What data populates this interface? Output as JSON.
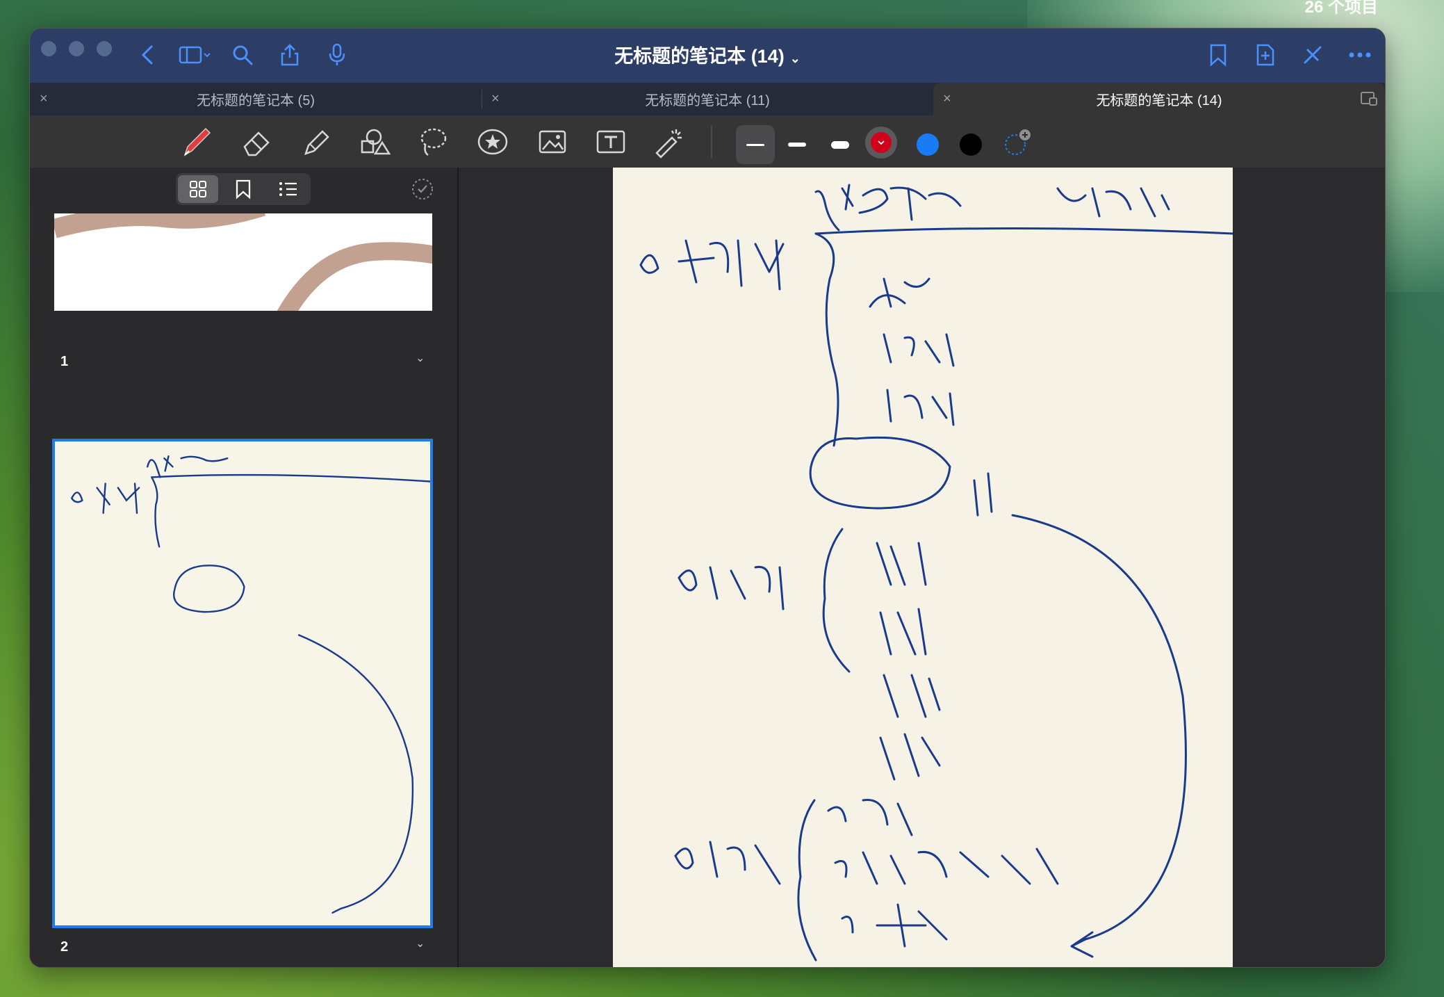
{
  "desktop": {
    "item_count": "26 个项目"
  },
  "window": {
    "title": "无标题的笔记本 (14)",
    "title_chevron": "⌄",
    "tabs": [
      {
        "label": "无标题的笔记本 (5)",
        "active": false
      },
      {
        "label": "无标题的笔记本 (11)",
        "active": false
      },
      {
        "label": "无标题的笔记本 (14)",
        "active": true
      }
    ],
    "tab_close_glyph": "×"
  },
  "toolbar": {
    "tools": [
      "pen-icon",
      "eraser-icon",
      "highlighter-icon",
      "shapes-icon",
      "lasso-icon",
      "sticker-icon",
      "image-icon",
      "text-icon",
      "laser-pointer-icon"
    ],
    "stroke_widths": [
      "thin",
      "medium",
      "thick"
    ],
    "colors": [
      "#d0021b",
      "#1a7cf5",
      "#000000"
    ],
    "selected_color": "#d0021b",
    "accent": "#4a90ff"
  },
  "sidebar": {
    "pages": [
      {
        "number": "1",
        "chevron": "⌄"
      },
      {
        "number": "2",
        "chevron": "⌄"
      }
    ]
  },
  "ink_color": "#1a3a8c"
}
